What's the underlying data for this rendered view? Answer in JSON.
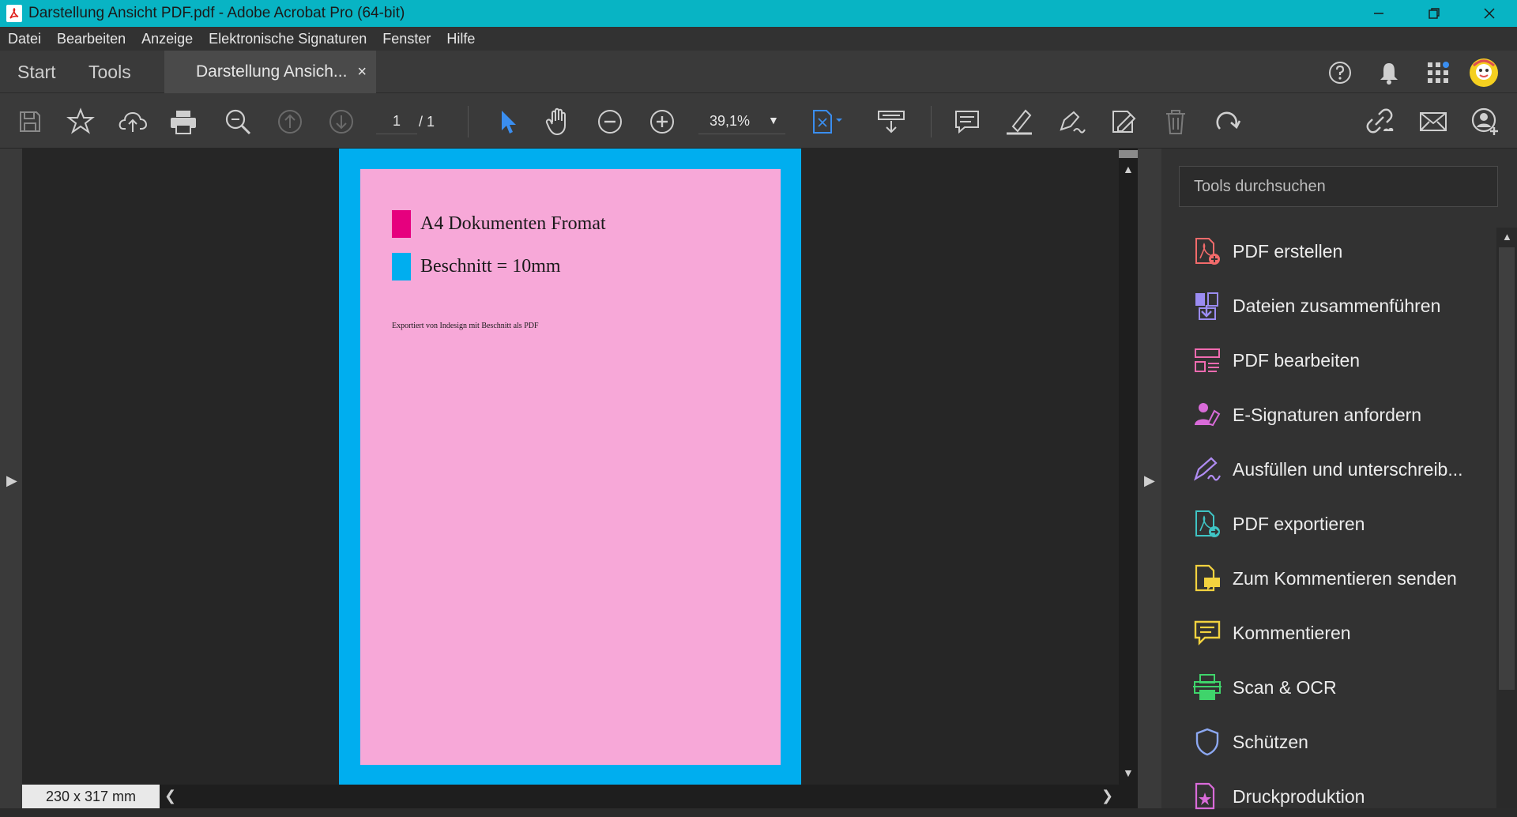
{
  "window": {
    "title": "Darstellung Ansicht PDF.pdf - Adobe Acrobat Pro (64-bit)"
  },
  "menu": [
    "Datei",
    "Bearbeiten",
    "Anzeige",
    "Elektronische Signaturen",
    "Fenster",
    "Hilfe"
  ],
  "tabs": {
    "start": "Start",
    "tools": "Tools",
    "document": "Darstellung Ansich...",
    "close": "×"
  },
  "toolbar": {
    "page_current": "1",
    "page_total": "/ 1",
    "zoom": "39,1%"
  },
  "document": {
    "line1": "A4 Dokumenten Fromat",
    "line2": "Beschnitt = 10mm",
    "note": "Exportiert von Indesign mit Beschnitt als PDF",
    "colors": {
      "bleed": "#00aeef",
      "trim": "#f7a8d8",
      "magenta": "#e6007e",
      "cyan": "#00aeef"
    }
  },
  "status": {
    "page_size": "230 x 317 mm"
  },
  "tools_pane": {
    "search_placeholder": "Tools durchsuchen",
    "items": [
      {
        "label": "PDF erstellen",
        "icon": "create-pdf-icon",
        "color": "#f26b6b"
      },
      {
        "label": "Dateien zusammenführen",
        "icon": "combine-files-icon",
        "color": "#9b8cf2"
      },
      {
        "label": "PDF bearbeiten",
        "icon": "edit-pdf-icon",
        "color": "#f06bb0"
      },
      {
        "label": "E-Signaturen anfordern",
        "icon": "request-esign-icon",
        "color": "#d96bd9"
      },
      {
        "label": "Ausfüllen und unterschreib...",
        "icon": "fill-sign-icon",
        "color": "#b08cf2"
      },
      {
        "label": "PDF exportieren",
        "icon": "export-pdf-icon",
        "color": "#3fc4c4"
      },
      {
        "label": "Zum Kommentieren senden",
        "icon": "send-comments-icon",
        "color": "#f2d23f"
      },
      {
        "label": "Kommentieren",
        "icon": "comment-icon",
        "color": "#f2d23f"
      },
      {
        "label": "Scan & OCR",
        "icon": "scan-ocr-icon",
        "color": "#3fd46b"
      },
      {
        "label": "Schützen",
        "icon": "protect-icon",
        "color": "#8ca8f2"
      },
      {
        "label": "Druckproduktion",
        "icon": "print-production-icon",
        "color": "#d96bd9"
      }
    ]
  }
}
